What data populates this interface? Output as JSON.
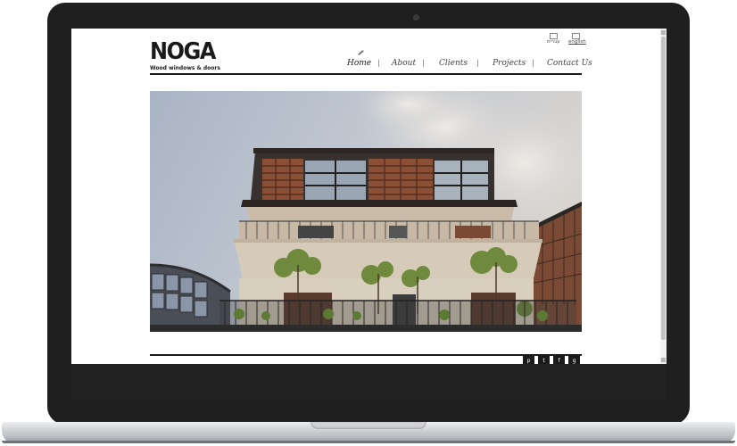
{
  "brand": {
    "name": "NOGA",
    "tagline": "Wood windows & doors"
  },
  "lang": {
    "hebrew": "עברית",
    "english": "english"
  },
  "nav": {
    "items": [
      {
        "id": "home",
        "label": "Home"
      },
      {
        "id": "about",
        "label": "About"
      },
      {
        "id": "clients",
        "label": "Clients"
      },
      {
        "id": "projects",
        "label": "Projects"
      },
      {
        "id": "contact",
        "label": "Contact Us"
      }
    ],
    "separator": "|"
  },
  "social": {
    "icons": [
      "pinterest-icon",
      "twitter-icon",
      "facebook-icon",
      "google-plus-icon"
    ],
    "labels": [
      "p",
      "t",
      "f",
      "g"
    ]
  },
  "colors": {
    "text": "#1a1a1a",
    "nav": "#444444",
    "frame": "#1f1f1f"
  }
}
